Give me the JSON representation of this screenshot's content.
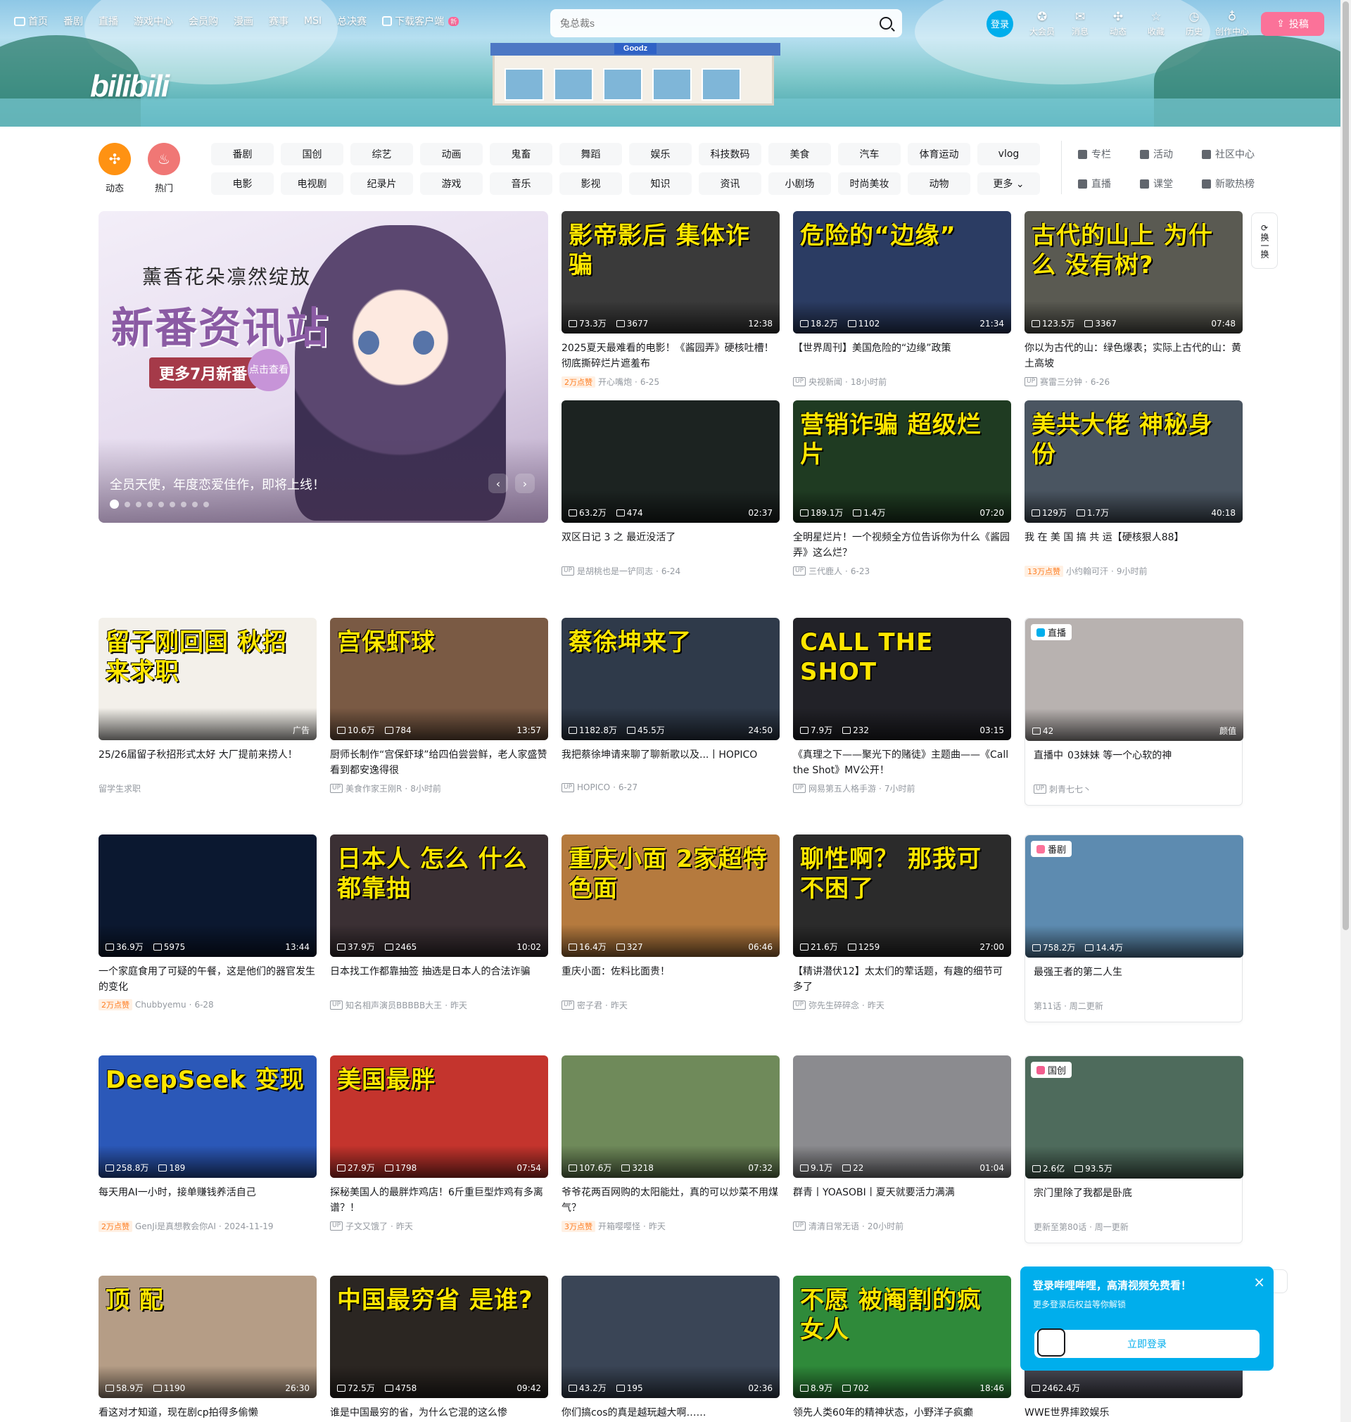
{
  "header": {
    "nav": [
      {
        "label": "首页",
        "icon": "tv-icon"
      },
      {
        "label": "番剧"
      },
      {
        "label": "直播"
      },
      {
        "label": "游戏中心"
      },
      {
        "label": "会员购"
      },
      {
        "label": "漫画"
      },
      {
        "label": "赛事"
      },
      {
        "label": "MSI"
      },
      {
        "label": "总决赛"
      },
      {
        "label": "下载客户端",
        "icon": "download-icon",
        "badge": "新"
      }
    ],
    "logo_text": "bilibili",
    "search_placeholder": "兔总裁s",
    "login_label": "登录",
    "tools": [
      {
        "label": "大会员",
        "icon": "vip-icon",
        "glyph": "✪"
      },
      {
        "label": "消息",
        "icon": "message-icon",
        "glyph": "✉"
      },
      {
        "label": "动态",
        "icon": "dynamic-icon",
        "glyph": "✣"
      },
      {
        "label": "收藏",
        "icon": "star-icon",
        "glyph": "☆"
      },
      {
        "label": "历史",
        "icon": "clock-icon",
        "glyph": "◷"
      },
      {
        "label": "创作中心",
        "icon": "bulb-icon",
        "glyph": "♁"
      }
    ],
    "upload_label": "投稿",
    "store_sign": "Goodz"
  },
  "channels": {
    "circles": [
      {
        "label": "动态",
        "color": "#ff9212",
        "glyph": "✣"
      },
      {
        "label": "热门",
        "color": "#f07775",
        "glyph": "♨"
      }
    ],
    "grid": [
      "番剧",
      "国创",
      "综艺",
      "动画",
      "鬼畜",
      "舞蹈",
      "娱乐",
      "科技数码",
      "美食",
      "汽车",
      "体育运动",
      "vlog",
      "电影",
      "电视剧",
      "纪录片",
      "游戏",
      "音乐",
      "影视",
      "知识",
      "资讯",
      "小剧场",
      "时尚美妆",
      "动物",
      "更多 ⌄"
    ],
    "links": [
      "专栏",
      "活动",
      "社区中心",
      "直播",
      "课堂",
      "新歌热榜"
    ]
  },
  "carousel": {
    "art_subtitle": "薰香花朵凛然绽放",
    "art_title": "新番资讯站",
    "art_badge": "更多7月新番",
    "art_badge2": "点击查看",
    "caption": "全员天使，年度恋爱佳作，即将上线！",
    "prev": "‹",
    "next": "›"
  },
  "refresh_label": "换一换",
  "cards": [
    {
      "thumb_text": "影帝影后 集体诈骗",
      "bg": "#3a3a3a",
      "views": "73.3万",
      "danmaku": "3677",
      "duration": "12:38",
      "title": "2025夏天最难看的电影！《酱园弄》硬核吐槽！彻底撕碎烂片遮羞布",
      "badge": "2万点赞",
      "author": "开心嘴炮",
      "date": "6-25"
    },
    {
      "thumb_text": "危险的“边缘”",
      "bg": "#2b3c63",
      "views": "18.2万",
      "danmaku": "1102",
      "duration": "21:34",
      "title": "【世界周刊】美国危险的“边缘”政策",
      "author": "央视新闻",
      "date": "18小时前"
    },
    {
      "thumb_text": "古代的山上 为什么 没有树?",
      "bg": "#5a5a52",
      "views": "123.5万",
      "danmaku": "3367",
      "duration": "07:48",
      "title": "你以为古代的山：绿色爆表；实际上古代的山：黄土高坡",
      "author": "赛雷三分钟",
      "date": "6-26"
    },
    {
      "thumb_text": "",
      "bg": "#1c2321",
      "views": "63.2万",
      "danmaku": "474",
      "duration": "02:37",
      "title": "双区日记 3 之 最近没活了",
      "author": "是胡桃也是一铲同志",
      "date": "6-24"
    },
    {
      "thumb_text": "营销诈骗 超级烂片",
      "bg": "#1f3b22",
      "views": "189.1万",
      "danmaku": "1.4万",
      "duration": "07:20",
      "title": "全明星烂片！一个视频全方位告诉你为什么《酱园弄》这么烂？",
      "author": "三代鹿人",
      "date": "6-23"
    },
    {
      "thumb_text": "美共大佬 神秘身份",
      "bg": "#4a5561",
      "views": "129万",
      "danmaku": "1.7万",
      "duration": "40:18",
      "title": "我 在 美 国 搞 共 运【硬核狠人88】",
      "badge": "13万点赞",
      "author": "小约翰可汗",
      "date": "9小时前"
    },
    {
      "thumb_text": "留子刚回国 秋招来求职",
      "bg": "#f3f0ea",
      "views": "",
      "danmaku": "",
      "duration": "广告",
      "title": "25/26届留子秋招形式太好 大厂提前来捞人！",
      "author": "留学生求职",
      "date": "",
      "ad": true
    },
    {
      "thumb_text": "宫保虾球",
      "bg": "#7a5a44",
      "views": "10.6万",
      "danmaku": "784",
      "duration": "13:57",
      "title": "厨师长制作“宫保虾球”给四伯尝尝鲜，老人家盛赞看到都安逸得很",
      "author": "美食作家王刚R",
      "date": "8小时前"
    },
    {
      "thumb_text": "蔡徐坤来了",
      "bg": "#2f3a4a",
      "views": "1182.8万",
      "danmaku": "45.5万",
      "duration": "24:50",
      "title": "我把蔡徐坤请来聊了聊新歌以及...丨HOPICO",
      "author": "HOPICO",
      "date": "6-27"
    },
    {
      "thumb_text": "CALL THE SHOT",
      "bg": "#222228",
      "views": "7.9万",
      "danmaku": "232",
      "duration": "03:15",
      "title": "《真理之下——聚光下的赌徒》主题曲——《Call the Shot》MV公开！",
      "author": "网易第五人格手游",
      "date": "7小时前"
    },
    {
      "thumb_text": "",
      "bg": "#b8b2b0",
      "views": "42",
      "danmaku": "",
      "duration": "颜值",
      "tag": "直播",
      "tag_color": "#00aeec",
      "title": "03妹妹 等一个心软的神",
      "live": "直播中",
      "author": "刺青七七丶",
      "date": ""
    },
    {
      "thumb_text": "",
      "bg": "#0b1830",
      "views": "36.9万",
      "danmaku": "5975",
      "duration": "13:44",
      "title": "一个家庭食用了可疑的午餐，这是他们的器官发生的变化",
      "badge": "2万点赞",
      "author": "Chubbyemu",
      "date": "6-28"
    },
    {
      "thumb_text": "日本人 怎么 什么都靠抽",
      "bg": "#3b3034",
      "views": "37.9万",
      "danmaku": "2465",
      "duration": "10:02",
      "title": "日本找工作都靠抽签 抽选是日本人的合法诈骗",
      "author": "知名相声演员BBBBB大王",
      "date": "昨天"
    },
    {
      "thumb_text": "重庆小面 2家超特色面",
      "bg": "#b57a3e",
      "views": "16.4万",
      "danmaku": "327",
      "duration": "06:46",
      "title": "重庆小面：佐料比面贵！",
      "author": "密子君",
      "date": "昨天"
    },
    {
      "thumb_text": "聊性啊？ 那我可不困了",
      "bg": "#2b2b2b",
      "views": "21.6万",
      "danmaku": "1259",
      "duration": "27:00",
      "title": "【精讲潜伏12】太太们的荤话题，有趣的细节可多了",
      "author": "弥先生碎碎念",
      "date": "昨天"
    },
    {
      "thumb_text": "",
      "bg": "#5d8bb0",
      "views": "758.2万",
      "danmaku": "14.4万",
      "duration": "",
      "tag": "番剧",
      "tag_color": "#fb7299",
      "title": "最强王者的第二人生",
      "author": "第11话 · 周二更新",
      "date": "",
      "bangumi": true
    },
    {
      "thumb_text": "DeepSeek 变现",
      "bg": "#2b58b8",
      "views": "258.8万",
      "danmaku": "189",
      "duration": "",
      "title": "每天用AI一小时，接单赚钱养活自己",
      "badge": "2万点赞",
      "author": "GenJi是真想教会你AI",
      "date": "2024-11-19"
    },
    {
      "thumb_text": "美国最胖",
      "bg": "#c4342d",
      "views": "27.9万",
      "danmaku": "1798",
      "duration": "07:54",
      "title": "探秘美国人的最胖炸鸡店！6斤重巨型炸鸡有多离谱？！",
      "author": "子文又饿了",
      "date": "昨天"
    },
    {
      "thumb_text": "",
      "bg": "#6f8a5a",
      "views": "107.6万",
      "danmaku": "3218",
      "duration": "07:32",
      "title": "爷爷花两百网购的太阳能灶，真的可以炒菜不用煤气？",
      "badge": "3万点赞",
      "author": "开箱嘤嘤怪",
      "date": "昨天"
    },
    {
      "thumb_text": "",
      "bg": "#8b8b8f",
      "views": "9.1万",
      "danmaku": "22",
      "duration": "01:04",
      "title": "群青丨YOASOBI丨夏天就要活力满满",
      "author": "清清日常无语",
      "date": "20小时前"
    },
    {
      "thumb_text": "",
      "bg": "#4e6b5c",
      "views": "2.6亿",
      "danmaku": "93.5万",
      "duration": "",
      "tag": "国创",
      "tag_color": "#f25d8e",
      "title": "宗门里除了我都是卧底",
      "author": "更新至第80话 · 周一更新",
      "date": "",
      "bangumi": true
    },
    {
      "thumb_text": "顶 配",
      "bg": "#b59d86",
      "views": "58.9万",
      "danmaku": "1190",
      "duration": "26:30",
      "title": "看这对才知道，现在剧cp拍得多偷懒",
      "author": "",
      "date": ""
    },
    {
      "thumb_text": "中国最穷省 是谁?",
      "bg": "#2b2622",
      "views": "72.5万",
      "danmaku": "4758",
      "duration": "09:42",
      "title": "谁是中国最穷的省，为什么它混的这么惨",
      "author": "",
      "date": ""
    },
    {
      "thumb_text": "",
      "bg": "#3a4556",
      "views": "43.2万",
      "danmaku": "195",
      "duration": "02:36",
      "title": "你们搞cos的真是越玩越大啊……",
      "author": "",
      "date": ""
    },
    {
      "thumb_text": "不愿 被阉割的疯女人",
      "bg": "#2f8a3a",
      "views": "8.9万",
      "danmaku": "702",
      "duration": "18:46",
      "title": "领先人类60年的精神状态，小野洋子疯癫",
      "author": "",
      "date": ""
    },
    {
      "thumb_text": "",
      "bg": "#4a4a55",
      "views": "2462.4万",
      "danmaku": "",
      "duration": "",
      "title": "WWE世界摔跤娱乐",
      "author": "",
      "date": ""
    }
  ],
  "login_popup": {
    "title": "登录哔哩哔哩，高清视频免费看！",
    "subtitle": "更多登录后权益等你解锁",
    "button": "立即登录",
    "close": "×"
  }
}
